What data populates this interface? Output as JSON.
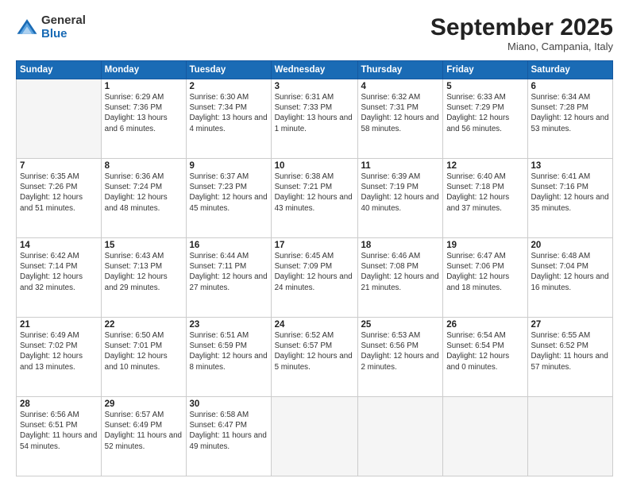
{
  "logo": {
    "general": "General",
    "blue": "Blue"
  },
  "header": {
    "month": "September 2025",
    "location": "Miano, Campania, Italy"
  },
  "days": [
    "Sunday",
    "Monday",
    "Tuesday",
    "Wednesday",
    "Thursday",
    "Friday",
    "Saturday"
  ],
  "weeks": [
    [
      {
        "num": "",
        "empty": true
      },
      {
        "num": "1",
        "sunrise": "6:29 AM",
        "sunset": "7:36 PM",
        "daylight": "13 hours and 6 minutes."
      },
      {
        "num": "2",
        "sunrise": "6:30 AM",
        "sunset": "7:34 PM",
        "daylight": "13 hours and 4 minutes."
      },
      {
        "num": "3",
        "sunrise": "6:31 AM",
        "sunset": "7:33 PM",
        "daylight": "13 hours and 1 minute."
      },
      {
        "num": "4",
        "sunrise": "6:32 AM",
        "sunset": "7:31 PM",
        "daylight": "12 hours and 58 minutes."
      },
      {
        "num": "5",
        "sunrise": "6:33 AM",
        "sunset": "7:29 PM",
        "daylight": "12 hours and 56 minutes."
      },
      {
        "num": "6",
        "sunrise": "6:34 AM",
        "sunset": "7:28 PM",
        "daylight": "12 hours and 53 minutes."
      }
    ],
    [
      {
        "num": "7",
        "sunrise": "6:35 AM",
        "sunset": "7:26 PM",
        "daylight": "12 hours and 51 minutes."
      },
      {
        "num": "8",
        "sunrise": "6:36 AM",
        "sunset": "7:24 PM",
        "daylight": "12 hours and 48 minutes."
      },
      {
        "num": "9",
        "sunrise": "6:37 AM",
        "sunset": "7:23 PM",
        "daylight": "12 hours and 45 minutes."
      },
      {
        "num": "10",
        "sunrise": "6:38 AM",
        "sunset": "7:21 PM",
        "daylight": "12 hours and 43 minutes."
      },
      {
        "num": "11",
        "sunrise": "6:39 AM",
        "sunset": "7:19 PM",
        "daylight": "12 hours and 40 minutes."
      },
      {
        "num": "12",
        "sunrise": "6:40 AM",
        "sunset": "7:18 PM",
        "daylight": "12 hours and 37 minutes."
      },
      {
        "num": "13",
        "sunrise": "6:41 AM",
        "sunset": "7:16 PM",
        "daylight": "12 hours and 35 minutes."
      }
    ],
    [
      {
        "num": "14",
        "sunrise": "6:42 AM",
        "sunset": "7:14 PM",
        "daylight": "12 hours and 32 minutes."
      },
      {
        "num": "15",
        "sunrise": "6:43 AM",
        "sunset": "7:13 PM",
        "daylight": "12 hours and 29 minutes."
      },
      {
        "num": "16",
        "sunrise": "6:44 AM",
        "sunset": "7:11 PM",
        "daylight": "12 hours and 27 minutes."
      },
      {
        "num": "17",
        "sunrise": "6:45 AM",
        "sunset": "7:09 PM",
        "daylight": "12 hours and 24 minutes."
      },
      {
        "num": "18",
        "sunrise": "6:46 AM",
        "sunset": "7:08 PM",
        "daylight": "12 hours and 21 minutes."
      },
      {
        "num": "19",
        "sunrise": "6:47 AM",
        "sunset": "7:06 PM",
        "daylight": "12 hours and 18 minutes."
      },
      {
        "num": "20",
        "sunrise": "6:48 AM",
        "sunset": "7:04 PM",
        "daylight": "12 hours and 16 minutes."
      }
    ],
    [
      {
        "num": "21",
        "sunrise": "6:49 AM",
        "sunset": "7:02 PM",
        "daylight": "12 hours and 13 minutes."
      },
      {
        "num": "22",
        "sunrise": "6:50 AM",
        "sunset": "7:01 PM",
        "daylight": "12 hours and 10 minutes."
      },
      {
        "num": "23",
        "sunrise": "6:51 AM",
        "sunset": "6:59 PM",
        "daylight": "12 hours and 8 minutes."
      },
      {
        "num": "24",
        "sunrise": "6:52 AM",
        "sunset": "6:57 PM",
        "daylight": "12 hours and 5 minutes."
      },
      {
        "num": "25",
        "sunrise": "6:53 AM",
        "sunset": "6:56 PM",
        "daylight": "12 hours and 2 minutes."
      },
      {
        "num": "26",
        "sunrise": "6:54 AM",
        "sunset": "6:54 PM",
        "daylight": "12 hours and 0 minutes."
      },
      {
        "num": "27",
        "sunrise": "6:55 AM",
        "sunset": "6:52 PM",
        "daylight": "11 hours and 57 minutes."
      }
    ],
    [
      {
        "num": "28",
        "sunrise": "6:56 AM",
        "sunset": "6:51 PM",
        "daylight": "11 hours and 54 minutes."
      },
      {
        "num": "29",
        "sunrise": "6:57 AM",
        "sunset": "6:49 PM",
        "daylight": "11 hours and 52 minutes."
      },
      {
        "num": "30",
        "sunrise": "6:58 AM",
        "sunset": "6:47 PM",
        "daylight": "11 hours and 49 minutes."
      },
      {
        "num": "",
        "empty": true
      },
      {
        "num": "",
        "empty": true
      },
      {
        "num": "",
        "empty": true
      },
      {
        "num": "",
        "empty": true
      }
    ]
  ]
}
